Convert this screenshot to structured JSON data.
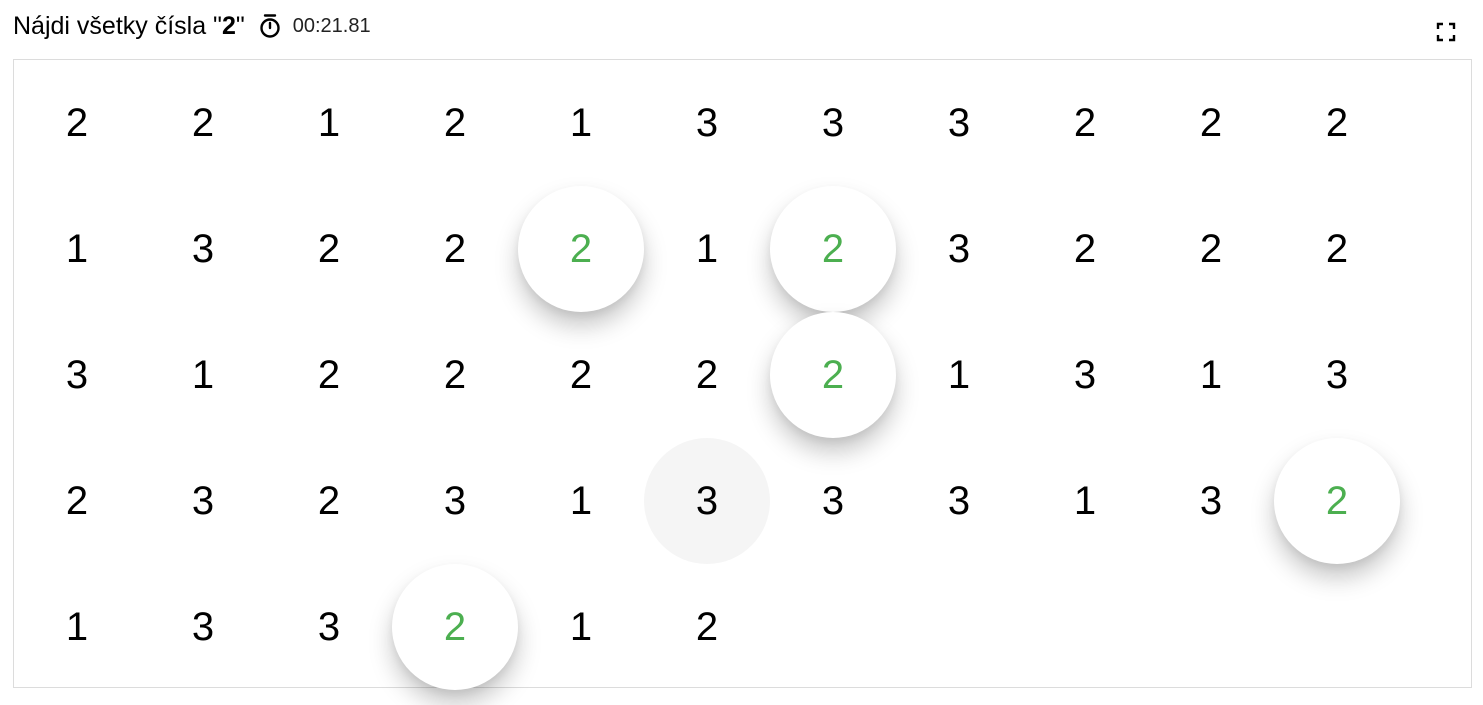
{
  "header": {
    "prefix": "Nájdi všetky čísla \"",
    "target": "2",
    "suffix": "\"",
    "timer": "00:21.81"
  },
  "icons": {
    "timer": "stopwatch-icon",
    "fullscreen": "fullscreen-icon"
  },
  "colors": {
    "found": "#4caf50",
    "hover": "#f5f5f5",
    "border": "#dcdcdc"
  },
  "grid": {
    "columns": 11,
    "cells": [
      {
        "v": "2"
      },
      {
        "v": "2"
      },
      {
        "v": "1"
      },
      {
        "v": "2"
      },
      {
        "v": "1"
      },
      {
        "v": "3"
      },
      {
        "v": "3"
      },
      {
        "v": "3"
      },
      {
        "v": "2"
      },
      {
        "v": "2"
      },
      {
        "v": "2"
      },
      {
        "v": "1"
      },
      {
        "v": "3"
      },
      {
        "v": "2"
      },
      {
        "v": "2"
      },
      {
        "v": "2",
        "state": "found"
      },
      {
        "v": "1"
      },
      {
        "v": "2",
        "state": "found"
      },
      {
        "v": "3"
      },
      {
        "v": "2"
      },
      {
        "v": "2"
      },
      {
        "v": "2"
      },
      {
        "v": "3"
      },
      {
        "v": "1"
      },
      {
        "v": "2"
      },
      {
        "v": "2"
      },
      {
        "v": "2"
      },
      {
        "v": "2"
      },
      {
        "v": "2",
        "state": "found"
      },
      {
        "v": "1"
      },
      {
        "v": "3"
      },
      {
        "v": "1"
      },
      {
        "v": "3"
      },
      {
        "v": "2"
      },
      {
        "v": "3"
      },
      {
        "v": "2"
      },
      {
        "v": "3"
      },
      {
        "v": "1"
      },
      {
        "v": "3",
        "state": "hover"
      },
      {
        "v": "3"
      },
      {
        "v": "3"
      },
      {
        "v": "1"
      },
      {
        "v": "3"
      },
      {
        "v": "2",
        "state": "found"
      },
      {
        "v": "1"
      },
      {
        "v": "3"
      },
      {
        "v": "3"
      },
      {
        "v": "2",
        "state": "found"
      },
      {
        "v": "1"
      },
      {
        "v": "2"
      }
    ]
  }
}
